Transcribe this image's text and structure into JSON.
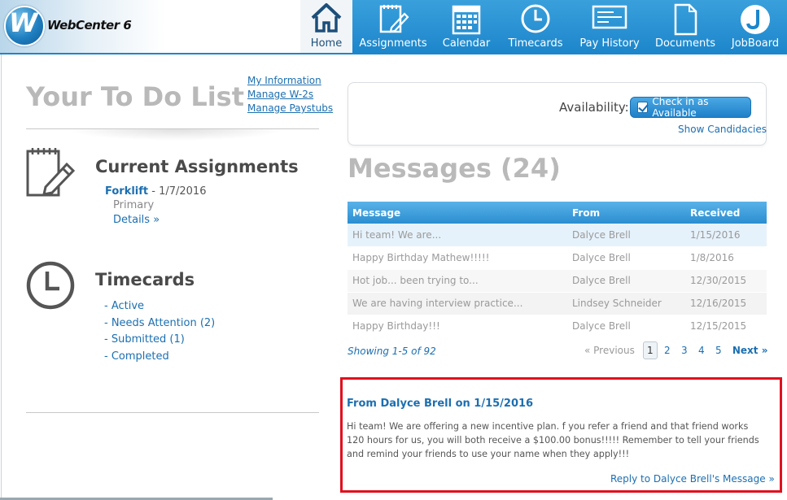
{
  "app": {
    "logo_letter": "W",
    "logo_text": "WebCenter 6"
  },
  "nav": {
    "home": "Home",
    "assignments": "Assignments",
    "calendar": "Calendar",
    "timecards": "Timecards",
    "pay_history": "Pay History",
    "documents": "Documents",
    "jobboard": "JobBoard"
  },
  "todo": {
    "title": "Your To Do List",
    "links": [
      "My Information",
      "Manage W-2s",
      "Manage Paystubs"
    ]
  },
  "current_assignments": {
    "title": "Current Assignments",
    "name": "Forklift",
    "date": " - 1/7/2016",
    "role": "Primary",
    "details": "Details »"
  },
  "timecards": {
    "title": "Timecards",
    "items": [
      "- Active",
      "- Needs Attention (2)",
      "- Submitted (1)",
      "- Completed"
    ]
  },
  "availability": {
    "label": "Availability:",
    "button": "Check in as Available",
    "show_candidacies": "Show Candidacies"
  },
  "messages": {
    "title": "Messages (24)",
    "columns": [
      "Message",
      "From",
      "Received"
    ],
    "rows": [
      [
        "Hi team! We are...",
        "Dalyce Brell",
        "1/15/2016"
      ],
      [
        "Happy Birthday Mathew!!!!!",
        "Dalyce Brell",
        "1/8/2016"
      ],
      [
        "Hot job... been trying to...",
        "Dalyce Brell",
        "12/30/2015"
      ],
      [
        "We are having interview practice...",
        "Lindsey Schneider",
        "12/16/2015"
      ],
      [
        "Happy Birthday!!!",
        "Dalyce Brell",
        "12/15/2015"
      ]
    ],
    "showing": "Showing 1-5 of 92",
    "pager": {
      "prev": "« Previous",
      "pages": [
        "1",
        "2",
        "3",
        "4",
        "5"
      ],
      "current": "1",
      "next": "Next »"
    }
  },
  "detail": {
    "title": "From Dalyce Brell on 1/15/2016",
    "body": "Hi team! We are offering a new incentive plan. f you refer a friend and that friend works 120 hours for us, you will both receive a $100.00 bonus!!!!! Remember to tell your friends and remind your friends to use your name when they apply!!!",
    "reply": "Reply to Dalyce Brell's Message »"
  },
  "colors": {
    "nav_blue": "#1c86cb",
    "link_blue": "#1c6fb0",
    "highlight_red": "#e0101e"
  }
}
